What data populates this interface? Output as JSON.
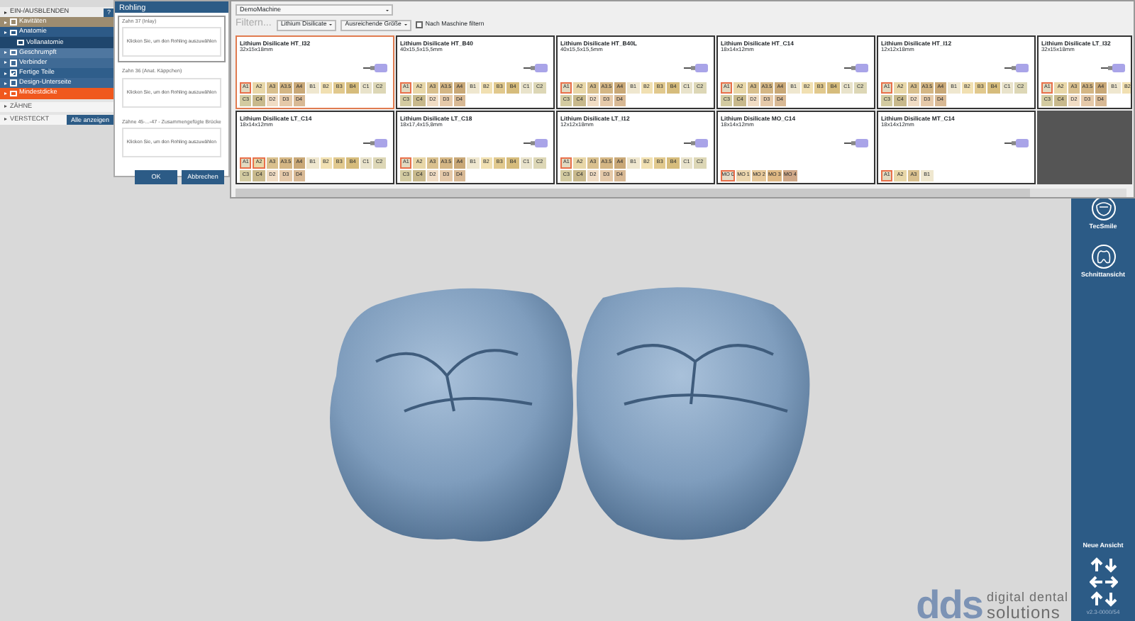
{
  "tree": {
    "header": "EIN-/AUSBLENDEN",
    "help_button": "?",
    "items": [
      {
        "label": "Kavitäten",
        "color": "#9d8c70",
        "checked": false
      },
      {
        "label": "Anatomie",
        "color": "#2d5a87",
        "checked": false,
        "children": [
          {
            "label": "Vollanatomie",
            "color": "#1f466d",
            "checked": false
          }
        ]
      },
      {
        "label": "Geschrumpft",
        "color": "#4f77a0",
        "checked": false
      },
      {
        "label": "Verbinder",
        "color": "#3f6a95",
        "checked": false
      },
      {
        "label": "Fertige Teile",
        "color": "#2f5e8b",
        "checked": true
      },
      {
        "label": "Design-Unterseite",
        "color": "#3a6693",
        "checked": false
      },
      {
        "label": "Mindestdicke",
        "color": "#f0581e",
        "checked": false
      }
    ],
    "sections": [
      {
        "label": "ZÄHNE"
      },
      {
        "label": "VERSTECKT",
        "button": "Alle anzeigen"
      }
    ]
  },
  "dialog": {
    "title": "Rohling",
    "slots": [
      {
        "label": "Zahn 37 (Inlay)",
        "prompt": "Klicken Sie, um den Rohling auszuwählen",
        "selected": true
      },
      {
        "label": "Zahn 36 (Anat. Käppchen)",
        "prompt": "Klicken Sie, um den Rohling auszuwählen",
        "selected": false
      },
      {
        "label": "Zähne 45-...-47 - Zusammengefügte Brücke",
        "prompt": "Klicken Sie, um den Rohling auszuwählen",
        "selected": false
      }
    ],
    "buttons": [
      "OK",
      "Abbrechen"
    ]
  },
  "materials": {
    "machine": "DemoMachine",
    "filter_placeholder": "Filtern...",
    "material_filter": "Lithium Disilicate",
    "size_filter": "Ausreichende Größe",
    "machine_filter": {
      "label": "Nach Maschine filtern",
      "checked": false
    },
    "blanks": [
      {
        "name": "Lithium Disilicate HT_I32",
        "size": "32x15x18mm",
        "selected": true,
        "shades": [
          [
            {
              "label": "A1",
              "color": "#e2d9c0",
              "selected": true
            },
            {
              "label": "A2",
              "color": "#e8d7a8",
              "selected": false
            },
            {
              "label": "A3",
              "color": "#d9c08e",
              "selected": false
            },
            {
              "label": "A3.5",
              "color": "#d4b684",
              "selected": false
            },
            {
              "label": "A4",
              "color": "#c9a877",
              "selected": false
            },
            {
              "label": "B1",
              "color": "#efe7cf",
              "selected": false
            },
            {
              "label": "B2",
              "color": "#f1e0b2",
              "selected": false
            },
            {
              "label": "B3",
              "color": "#e1c98e",
              "selected": false
            },
            {
              "label": "B4",
              "color": "#d6bc7c",
              "selected": false
            },
            {
              "label": "C1",
              "color": "#e9e3cb",
              "selected": false
            },
            {
              "label": "C2",
              "color": "#ddd7b6",
              "selected": false
            }
          ],
          [
            {
              "label": "C3",
              "color": "#d3cba1",
              "selected": false
            },
            {
              "label": "C4",
              "color": "#c8b98c",
              "selected": false
            },
            {
              "label": "D2",
              "color": "#f0dcc4",
              "selected": false
            },
            {
              "label": "D3",
              "color": "#e5c9a9",
              "selected": false
            },
            {
              "label": "D4",
              "color": "#d8b995",
              "selected": false
            }
          ]
        ]
      },
      {
        "name": "Lithium Disilicate HT_B40",
        "size": "40x15,5x15,5mm",
        "selected": false,
        "shades": [
          [
            {
              "label": "A1",
              "color": "#e2d9c0",
              "selected": true
            },
            {
              "label": "A2",
              "color": "#e8d7a8",
              "selected": false
            },
            {
              "label": "A3",
              "color": "#d9c08e",
              "selected": false
            },
            {
              "label": "A3.5",
              "color": "#d4b684",
              "selected": false
            },
            {
              "label": "A4",
              "color": "#c9a877",
              "selected": false
            },
            {
              "label": "B1",
              "color": "#efe7cf",
              "selected": false
            },
            {
              "label": "B2",
              "color": "#f1e0b2",
              "selected": false
            },
            {
              "label": "B3",
              "color": "#e1c98e",
              "selected": false
            },
            {
              "label": "B4",
              "color": "#d6bc7c",
              "selected": false
            },
            {
              "label": "C1",
              "color": "#e9e3cb",
              "selected": false
            },
            {
              "label": "C2",
              "color": "#ddd7b6",
              "selected": false
            }
          ],
          [
            {
              "label": "C3",
              "color": "#d3cba1",
              "selected": false
            },
            {
              "label": "C4",
              "color": "#c8b98c",
              "selected": false
            },
            {
              "label": "D2",
              "color": "#f0dcc4",
              "selected": false
            },
            {
              "label": "D3",
              "color": "#e5c9a9",
              "selected": false
            },
            {
              "label": "D4",
              "color": "#d8b995",
              "selected": false
            }
          ]
        ]
      },
      {
        "name": "Lithium Disilicate HT_B40L",
        "size": "40x15,5x15,5mm",
        "selected": false,
        "shades": [
          [
            {
              "label": "A1",
              "color": "#e2d9c0",
              "selected": true
            },
            {
              "label": "A2",
              "color": "#e8d7a8",
              "selected": false
            },
            {
              "label": "A3",
              "color": "#d9c08e",
              "selected": false
            },
            {
              "label": "A3.5",
              "color": "#d4b684",
              "selected": false
            },
            {
              "label": "A4",
              "color": "#c9a877",
              "selected": false
            },
            {
              "label": "B1",
              "color": "#efe7cf",
              "selected": false
            },
            {
              "label": "B2",
              "color": "#f1e0b2",
              "selected": false
            },
            {
              "label": "B3",
              "color": "#e1c98e",
              "selected": false
            },
            {
              "label": "B4",
              "color": "#d6bc7c",
              "selected": false
            },
            {
              "label": "C1",
              "color": "#e9e3cb",
              "selected": false
            },
            {
              "label": "C2",
              "color": "#ddd7b6",
              "selected": false
            }
          ],
          [
            {
              "label": "C3",
              "color": "#d3cba1",
              "selected": false
            },
            {
              "label": "C4",
              "color": "#c8b98c",
              "selected": false
            },
            {
              "label": "D2",
              "color": "#f0dcc4",
              "selected": false
            },
            {
              "label": "D3",
              "color": "#e5c9a9",
              "selected": false
            },
            {
              "label": "D4",
              "color": "#d8b995",
              "selected": false
            }
          ]
        ]
      },
      {
        "name": "Lithium Disilicate HT_C14",
        "size": "18x14x12mm",
        "selected": false,
        "shades": [
          [
            {
              "label": "A1",
              "color": "#e2d9c0",
              "selected": true
            },
            {
              "label": "A2",
              "color": "#e8d7a8",
              "selected": false
            },
            {
              "label": "A3",
              "color": "#d9c08e",
              "selected": false
            },
            {
              "label": "A3.5",
              "color": "#d4b684",
              "selected": false
            },
            {
              "label": "A4",
              "color": "#c9a877",
              "selected": false
            },
            {
              "label": "B1",
              "color": "#efe7cf",
              "selected": false
            },
            {
              "label": "B2",
              "color": "#f1e0b2",
              "selected": false
            },
            {
              "label": "B3",
              "color": "#e1c98e",
              "selected": false
            },
            {
              "label": "B4",
              "color": "#d6bc7c",
              "selected": false
            },
            {
              "label": "C1",
              "color": "#e9e3cb",
              "selected": false
            },
            {
              "label": "C2",
              "color": "#ddd7b6",
              "selected": false
            }
          ],
          [
            {
              "label": "C3",
              "color": "#d3cba1",
              "selected": false
            },
            {
              "label": "C4",
              "color": "#c8b98c",
              "selected": false
            },
            {
              "label": "D2",
              "color": "#f0dcc4",
              "selected": false
            },
            {
              "label": "D3",
              "color": "#e5c9a9",
              "selected": false
            },
            {
              "label": "D4",
              "color": "#d8b995",
              "selected": false
            }
          ]
        ]
      },
      {
        "name": "Lithium Disilicate HT_I12",
        "size": "12x12x18mm",
        "selected": false,
        "shades": [
          [
            {
              "label": "A1",
              "color": "#e2d9c0",
              "selected": true
            },
            {
              "label": "A2",
              "color": "#e8d7a8",
              "selected": false
            },
            {
              "label": "A3",
              "color": "#d9c08e",
              "selected": false
            },
            {
              "label": "A3.5",
              "color": "#d4b684",
              "selected": false
            },
            {
              "label": "A4",
              "color": "#c9a877",
              "selected": false
            },
            {
              "label": "B1",
              "color": "#efe7cf",
              "selected": false
            },
            {
              "label": "B2",
              "color": "#f1e0b2",
              "selected": false
            },
            {
              "label": "B3",
              "color": "#e1c98e",
              "selected": false
            },
            {
              "label": "B4",
              "color": "#d6bc7c",
              "selected": false
            },
            {
              "label": "C1",
              "color": "#e9e3cb",
              "selected": false
            },
            {
              "label": "C2",
              "color": "#ddd7b6",
              "selected": false
            }
          ],
          [
            {
              "label": "C3",
              "color": "#d3cba1",
              "selected": false
            },
            {
              "label": "C4",
              "color": "#c8b98c",
              "selected": false
            },
            {
              "label": "D2",
              "color": "#f0dcc4",
              "selected": false
            },
            {
              "label": "D3",
              "color": "#e5c9a9",
              "selected": false
            },
            {
              "label": "D4",
              "color": "#d8b995",
              "selected": false
            }
          ]
        ]
      },
      {
        "name": "Lithium Disilicate LT_I32",
        "size": "32x15x18mm",
        "selected": false,
        "shades": [
          [
            {
              "label": "A1",
              "color": "#e2d9c0",
              "selected": true
            },
            {
              "label": "A2",
              "color": "#e8d7a8",
              "selected": false
            },
            {
              "label": "A3",
              "color": "#d9c08e",
              "selected": false
            },
            {
              "label": "A3.5",
              "color": "#d4b684",
              "selected": false
            },
            {
              "label": "A4",
              "color": "#c9a877",
              "selected": false
            },
            {
              "label": "B1",
              "color": "#efe7cf",
              "selected": false
            },
            {
              "label": "B2",
              "color": "#f1e0b2",
              "selected": false
            }
          ],
          [
            {
              "label": "C3",
              "color": "#d3cba1",
              "selected": false
            },
            {
              "label": "C4",
              "color": "#c8b98c",
              "selected": false
            },
            {
              "label": "D2",
              "color": "#f0dcc4",
              "selected": false
            },
            {
              "label": "D3",
              "color": "#e5c9a9",
              "selected": false
            },
            {
              "label": "D4",
              "color": "#d8b995",
              "selected": false
            }
          ]
        ]
      },
      {
        "name": "Lithium Disilicate LT_C14",
        "size": "18x14x12mm",
        "selected": false,
        "shades": [
          [
            {
              "label": "A1",
              "color": "#e2d9c0",
              "selected": true
            },
            {
              "label": "A2",
              "color": "#e8d7a8",
              "selected": true
            },
            {
              "label": "A3",
              "color": "#d9c08e",
              "selected": false
            },
            {
              "label": "A3.5",
              "color": "#d4b684",
              "selected": false
            },
            {
              "label": "A4",
              "color": "#c9a877",
              "selected": false
            },
            {
              "label": "B1",
              "color": "#efe7cf",
              "selected": false
            },
            {
              "label": "B2",
              "color": "#f1e0b2",
              "selected": false
            },
            {
              "label": "B3",
              "color": "#e1c98e",
              "selected": false
            },
            {
              "label": "B4",
              "color": "#d6bc7c",
              "selected": false
            },
            {
              "label": "C1",
              "color": "#e9e3cb",
              "selected": false
            },
            {
              "label": "C2",
              "color": "#ddd7b6",
              "selected": false
            }
          ],
          [
            {
              "label": "C3",
              "color": "#d3cba1",
              "selected": false
            },
            {
              "label": "C4",
              "color": "#c8b98c",
              "selected": false
            },
            {
              "label": "D2",
              "color": "#f0dcc4",
              "selected": false
            },
            {
              "label": "D3",
              "color": "#e5c9a9",
              "selected": false
            },
            {
              "label": "D4",
              "color": "#d8b995",
              "selected": false
            }
          ]
        ]
      },
      {
        "name": "Lithium Disilicate LT_C18",
        "size": "18x17,4x15,8mm",
        "selected": false,
        "shades": [
          [
            {
              "label": "A1",
              "color": "#e2d9c0",
              "selected": true
            },
            {
              "label": "A2",
              "color": "#e8d7a8",
              "selected": false
            },
            {
              "label": "A3",
              "color": "#d9c08e",
              "selected": false
            },
            {
              "label": "A3.5",
              "color": "#d4b684",
              "selected": false
            },
            {
              "label": "A4",
              "color": "#c9a877",
              "selected": false
            },
            {
              "label": "B1",
              "color": "#efe7cf",
              "selected": false
            },
            {
              "label": "B2",
              "color": "#f1e0b2",
              "selected": false
            },
            {
              "label": "B3",
              "color": "#e1c98e",
              "selected": false
            },
            {
              "label": "B4",
              "color": "#d6bc7c",
              "selected": false
            },
            {
              "label": "C1",
              "color": "#e9e3cb",
              "selected": false
            },
            {
              "label": "C2",
              "color": "#ddd7b6",
              "selected": false
            }
          ],
          [
            {
              "label": "C3",
              "color": "#d3cba1",
              "selected": false
            },
            {
              "label": "C4",
              "color": "#c8b98c",
              "selected": false
            },
            {
              "label": "D2",
              "color": "#f0dcc4",
              "selected": false
            },
            {
              "label": "D3",
              "color": "#e5c9a9",
              "selected": false
            },
            {
              "label": "D4",
              "color": "#d8b995",
              "selected": false
            }
          ]
        ]
      },
      {
        "name": "Lithium Disilicate LT_I12",
        "size": "12x12x18mm",
        "selected": false,
        "shades": [
          [
            {
              "label": "A1",
              "color": "#e2d9c0",
              "selected": true
            },
            {
              "label": "A2",
              "color": "#e8d7a8",
              "selected": false
            },
            {
              "label": "A3",
              "color": "#d9c08e",
              "selected": false
            },
            {
              "label": "A3.5",
              "color": "#d4b684",
              "selected": false
            },
            {
              "label": "A4",
              "color": "#c9a877",
              "selected": false
            },
            {
              "label": "B1",
              "color": "#efe7cf",
              "selected": false
            },
            {
              "label": "B2",
              "color": "#f1e0b2",
              "selected": false
            },
            {
              "label": "B3",
              "color": "#e1c98e",
              "selected": false
            },
            {
              "label": "B4",
              "color": "#d6bc7c",
              "selected": false
            },
            {
              "label": "C1",
              "color": "#e9e3cb",
              "selected": false
            },
            {
              "label": "C2",
              "color": "#ddd7b6",
              "selected": false
            }
          ],
          [
            {
              "label": "C3",
              "color": "#d3cba1",
              "selected": false
            },
            {
              "label": "C4",
              "color": "#c8b98c",
              "selected": false
            },
            {
              "label": "D2",
              "color": "#f0dcc4",
              "selected": false
            },
            {
              "label": "D3",
              "color": "#e5c9a9",
              "selected": false
            },
            {
              "label": "D4",
              "color": "#d8b995",
              "selected": false
            }
          ]
        ]
      },
      {
        "name": "Lithium Disilicate MO_C14",
        "size": "18x14x12mm",
        "selected": false,
        "shades": [
          [
            {
              "label": "MO 0",
              "color": "#e6dcc8",
              "selected": true
            },
            {
              "label": "MO 1",
              "color": "#ecd6ae",
              "selected": false
            },
            {
              "label": "MO 2",
              "color": "#e6c89a",
              "selected": false
            },
            {
              "label": "MO 3",
              "color": "#dfb883",
              "selected": false
            },
            {
              "label": "MO 4",
              "color": "#cfa888",
              "selected": false
            }
          ]
        ]
      },
      {
        "name": "Lithium Disilicate MT_C14",
        "size": "18x14x12mm",
        "selected": false,
        "shades": [
          [
            {
              "label": "A1",
              "color": "#e2d9c0",
              "selected": true
            },
            {
              "label": "A2",
              "color": "#e8d7a8",
              "selected": false
            },
            {
              "label": "A3",
              "color": "#d9c08e",
              "selected": false
            },
            {
              "label": "B1",
              "color": "#efe7cf",
              "selected": false
            }
          ]
        ]
      }
    ]
  },
  "sidebar": {
    "tools": [
      {
        "label": "TecSmile",
        "kind": "smile"
      },
      {
        "label": "Schnittansicht",
        "kind": "section"
      }
    ],
    "view_label": "Neue Ansicht",
    "version": "v2.3-0000/54"
  },
  "logo": {
    "mark": "dds",
    "line1": "digital dental",
    "line2": "solutions"
  }
}
